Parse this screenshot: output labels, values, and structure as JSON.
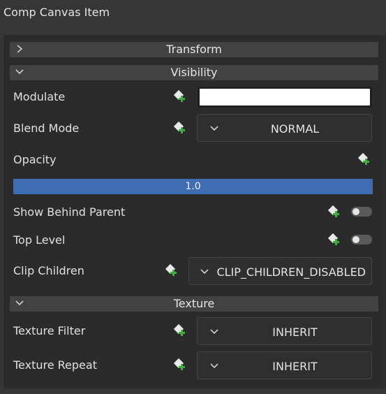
{
  "title": "Comp Canvas Item",
  "sections": {
    "transform": {
      "label": "Transform",
      "expanded": false
    },
    "visibility": {
      "label": "Visibility",
      "expanded": true
    },
    "texture": {
      "label": "Texture",
      "expanded": true
    }
  },
  "properties": {
    "modulate": {
      "label": "Modulate",
      "color": "#ffffff"
    },
    "blend_mode": {
      "label": "Blend Mode",
      "value": "NORMAL"
    },
    "opacity": {
      "label": "Opacity",
      "value": "1.0",
      "fraction": 1.0
    },
    "show_behind_parent": {
      "label": "Show Behind Parent",
      "checked": false
    },
    "top_level": {
      "label": "Top Level",
      "checked": false
    },
    "clip_children": {
      "label": "Clip Children",
      "value": "CLIP_CHILDREN_DISABLED"
    },
    "texture_filter": {
      "label": "Texture Filter",
      "value": "INHERIT"
    },
    "texture_repeat": {
      "label": "Texture Repeat",
      "value": "INHERIT"
    }
  },
  "icons": {
    "keyframe": "keyframe-add-icon",
    "collapsed": "chevron-right-icon",
    "expanded": "chevron-down-icon"
  },
  "colors": {
    "accent": "#3f6db4",
    "keyframe_plus": "#3bb33b"
  }
}
